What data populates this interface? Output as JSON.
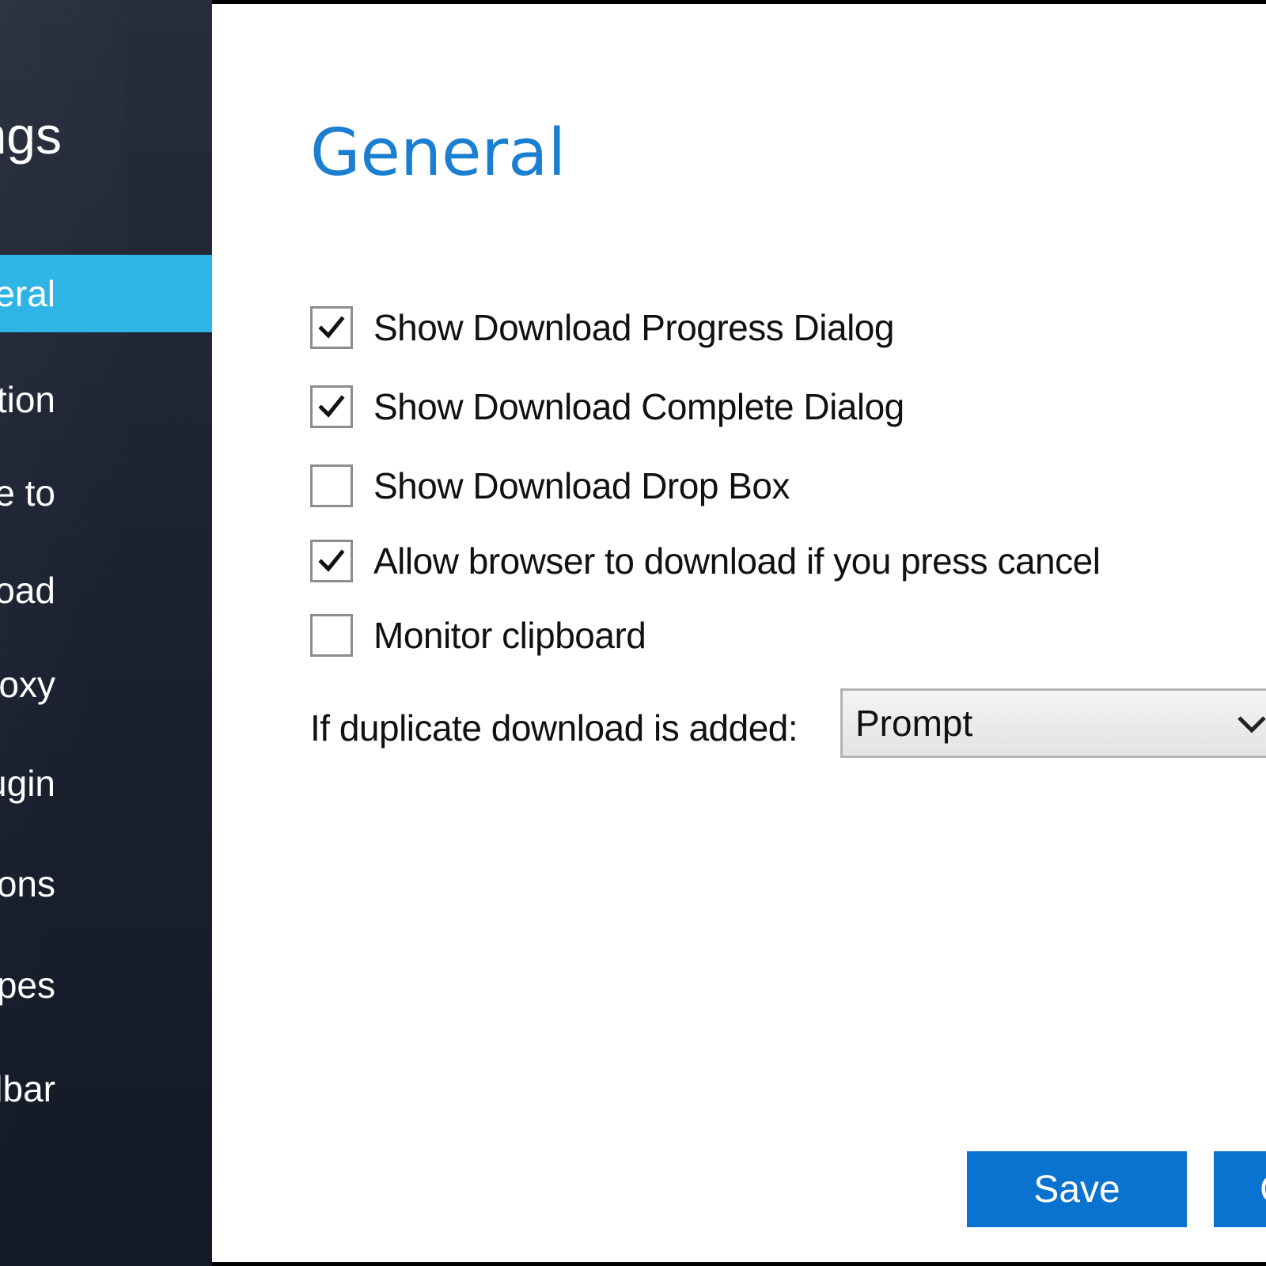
{
  "sidebar": {
    "title": "Settings",
    "items": [
      {
        "label": "General",
        "active": true
      },
      {
        "label": "Connection",
        "active": false
      },
      {
        "label": "Save to",
        "active": false
      },
      {
        "label": "Download",
        "active": false
      },
      {
        "label": "Proxy",
        "active": false
      },
      {
        "label": "Browser Plugin",
        "active": false
      },
      {
        "label": "Exceptions",
        "active": false
      },
      {
        "label": "File types",
        "active": false
      },
      {
        "label": "Toolbar",
        "active": false
      }
    ]
  },
  "main": {
    "title": "General",
    "options": [
      {
        "label": "Show Download Progress Dialog",
        "checked": true
      },
      {
        "label": "Show Download Complete Dialog",
        "checked": true
      },
      {
        "label": "Show Download Drop Box",
        "checked": false
      },
      {
        "label": "Allow browser to download if you press cancel",
        "checked": true
      },
      {
        "label": "Monitor clipboard",
        "checked": false
      }
    ],
    "duplicate": {
      "label": "If duplicate download is added:",
      "value": "Prompt"
    },
    "buttons": {
      "save": "Save",
      "cancel": "Cancel"
    }
  },
  "colors": {
    "accent": "#1b7fd1",
    "button": "#0a72cf",
    "sidebar_active": "#2fb4e6",
    "sidebar_bg": "#1c2231"
  },
  "icons": {
    "checkbox_mark": "check-icon",
    "dropdown": "chevron-down-icon"
  }
}
